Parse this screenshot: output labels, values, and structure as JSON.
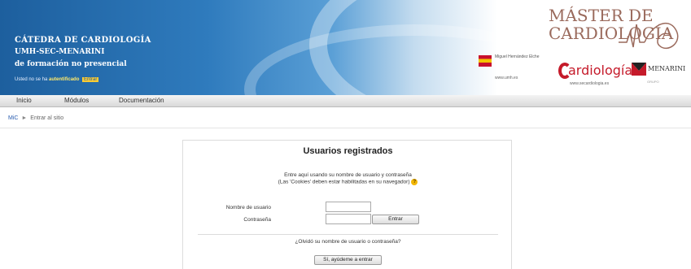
{
  "header": {
    "line1": "CÁTEDRA DE CARDIOLOGÍA",
    "line2": "UMH-SEC-MENARINI",
    "line3": "de formación no presencial",
    "login_status_prefix": "Usted no se ha",
    "login_status_user": "autentificado",
    "login_status_exit": "Entrar",
    "partner_logo_text": "Miguel Hernández Elche",
    "partner_url": "www.umh.es",
    "master_line1": "MÁSTER DE",
    "master_line2": "CARDIOLOGÍA",
    "cardio_logo_text": "ardiología",
    "cardio_url": "www.secardiologia.es",
    "menarini_text": "MENARINI",
    "menarini_sub": "GRUPO"
  },
  "nav": {
    "items": [
      "Inicio",
      "Módulos",
      "Documentación"
    ]
  },
  "breadcrumb": {
    "home": "MiC",
    "separator": "►",
    "current": "Entrar al sitio"
  },
  "login": {
    "title": "Usuarios registrados",
    "intro_line1": "Entre aquí usando su nombre de usuario y contraseña",
    "intro_line2": "(Las 'Cookies' deben estar habilitadas en su navegador)",
    "help_icon": "?",
    "username_label": "Nombre de usuario",
    "username_value": "",
    "password_label": "Contraseña",
    "password_value": "",
    "submit_label": "Entrar",
    "forgot_text": "¿Olvidó su nombre de usuario o contraseña?",
    "forgot_button": "Sí, ayúdeme a entrar"
  },
  "colors": {
    "banner_blue": "#2f7bbd",
    "cardio_red": "#c51a2a",
    "master_brown": "#9a6a5c"
  }
}
